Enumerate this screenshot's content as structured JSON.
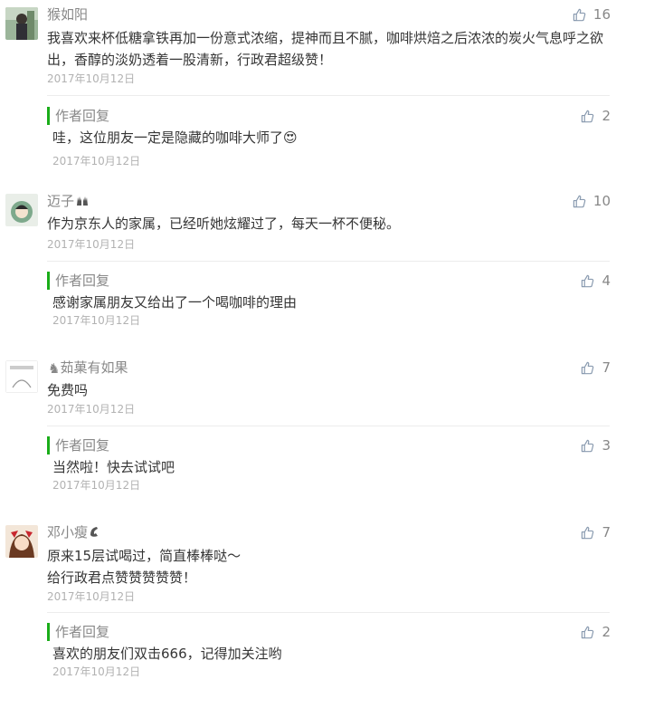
{
  "comments": [
    {
      "nickname": "猴如阳",
      "content": "我喜欢来杯低糖拿铁再加一份意式浓缩，提神而且不腻，咖啡烘焙之后浓浓的炭火气息呼之欲出，香醇的淡奶透着一股清新，行政君超级赞！",
      "date": "2017年10月12日",
      "likes": "16",
      "reply": {
        "label": "作者回复",
        "content": "哇，这位朋友一定是隐藏的咖啡大师了😍",
        "date": "2017年10月12日",
        "likes": "2"
      }
    },
    {
      "nickname": "迈子",
      "nickname_icon": "hands-emoji-icon",
      "content": "作为京东人的家属，已经听她炫耀过了，每天一杯不便秘。",
      "date": "2017年10月12日",
      "likes": "10",
      "reply": {
        "label": "作者回复",
        "content": "感谢家属朋友又给出了一个喝咖啡的理由",
        "date": "2017年10月12日",
        "likes": "4"
      }
    },
    {
      "nickname": "茹菓有如果",
      "nickname_icon": "chess-knight-icon",
      "content": "免费吗",
      "date": "2017年10月12日",
      "likes": "7",
      "reply": {
        "label": "作者回复",
        "content": "当然啦！快去试试吧",
        "date": "2017年10月12日",
        "likes": "3"
      }
    },
    {
      "nickname": "邓小瘦",
      "nickname_icon": "phone-emoji-icon",
      "content": "原来15层试喝过，简直棒棒哒～\n给行政君点赞赞赞赞赞！",
      "date": "2017年10月12日",
      "likes": "7",
      "reply": {
        "label": "作者回复",
        "content": "喜欢的朋友们双击666，记得加关注哟",
        "date": "2017年10月12日",
        "likes": "2"
      }
    }
  ],
  "colors": {
    "accent": "#1aad19",
    "meta": "#888888",
    "date": "#b2b2b2",
    "text": "#353535",
    "divider": "#ececec"
  }
}
